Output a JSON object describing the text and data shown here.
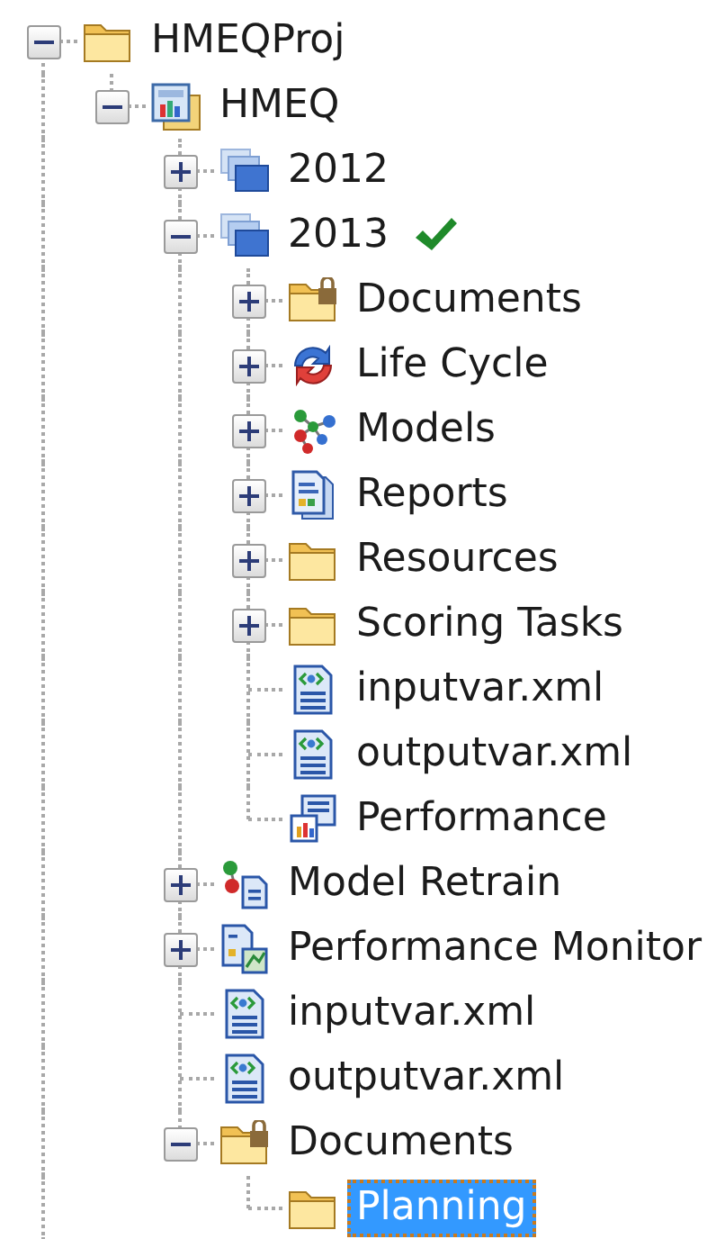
{
  "tree": [
    {
      "label": "HMEQProj",
      "kind": "folder",
      "expanded": true,
      "selected": false,
      "children": [
        {
          "label": "HMEQ",
          "kind": "project",
          "expanded": true,
          "selected": false,
          "children": [
            {
              "label": "2012",
              "kind": "version",
              "expanded": false,
              "selected": false,
              "verified": false
            },
            {
              "label": "2013",
              "kind": "version",
              "expanded": true,
              "selected": false,
              "verified": true,
              "children": [
                {
                  "label": "Documents",
                  "kind": "locked-folder",
                  "expanded": false,
                  "selected": false
                },
                {
                  "label": "Life Cycle",
                  "kind": "lifecycle",
                  "expanded": false,
                  "selected": false
                },
                {
                  "label": "Models",
                  "kind": "models",
                  "expanded": false,
                  "selected": false
                },
                {
                  "label": "Reports",
                  "kind": "reports",
                  "expanded": false,
                  "selected": false
                },
                {
                  "label": "Resources",
                  "kind": "folder",
                  "expanded": false,
                  "selected": false
                },
                {
                  "label": "Scoring Tasks",
                  "kind": "folder",
                  "expanded": false,
                  "selected": false
                },
                {
                  "label": "inputvar.xml",
                  "kind": "xml",
                  "selected": false
                },
                {
                  "label": "outputvar.xml",
                  "kind": "xml",
                  "selected": false
                },
                {
                  "label": "Performance",
                  "kind": "performance",
                  "selected": false
                }
              ]
            },
            {
              "label": "Model Retrain",
              "kind": "retrain",
              "expanded": false,
              "selected": false
            },
            {
              "label": "Performance Monitor",
              "kind": "monitor",
              "expanded": false,
              "selected": false
            },
            {
              "label": "inputvar.xml",
              "kind": "xml",
              "selected": false
            },
            {
              "label": "outputvar.xml",
              "kind": "xml",
              "selected": false
            },
            {
              "label": "Documents",
              "kind": "locked-folder",
              "expanded": true,
              "selected": false,
              "children": [
                {
                  "label": "Planning",
                  "kind": "folder",
                  "selected": true
                }
              ]
            }
          ]
        }
      ]
    }
  ]
}
